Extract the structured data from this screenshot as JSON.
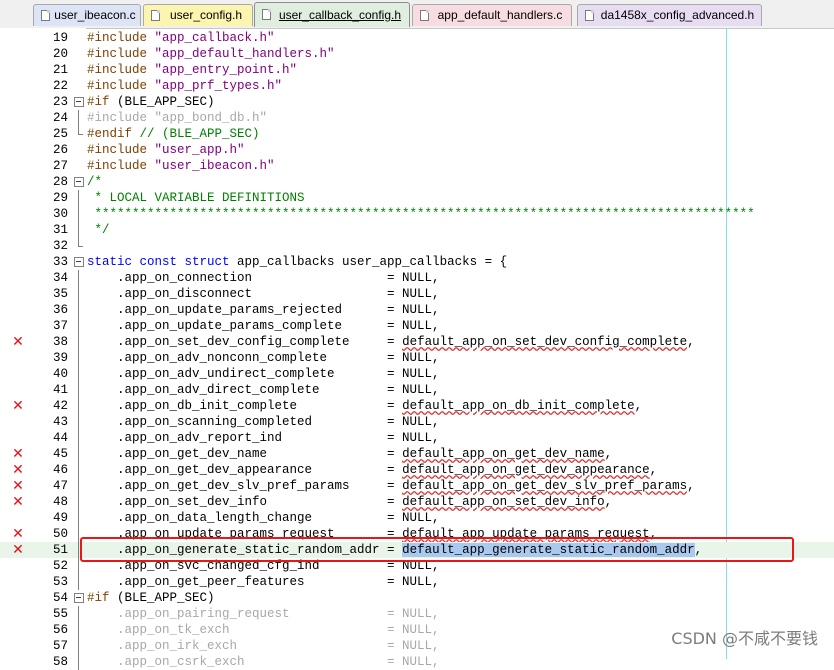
{
  "tabs": [
    {
      "label": "user_ibeacon.c",
      "bg": "#dde4f5",
      "active": false
    },
    {
      "label": "user_config.h",
      "bg": "#fbf5b0",
      "active": false
    },
    {
      "label": "user_callback_config.h",
      "bg": "#dfeede",
      "active": true
    },
    {
      "label": "app_default_handlers.c",
      "bg": "#f7dde2",
      "active": false
    },
    {
      "label": "da1458x_config_advanced.h",
      "bg": "#e6ddf2",
      "active": false
    }
  ],
  "lines": [
    {
      "num": "19",
      "fold": "",
      "marker": false,
      "tokens": [
        [
          "pp",
          "#include "
        ],
        [
          "str",
          "\"app_callback.h\""
        ]
      ]
    },
    {
      "num": "20",
      "fold": "",
      "marker": false,
      "tokens": [
        [
          "pp",
          "#include "
        ],
        [
          "str",
          "\"app_default_handlers.h\""
        ]
      ]
    },
    {
      "num": "21",
      "fold": "",
      "marker": false,
      "tokens": [
        [
          "pp",
          "#include "
        ],
        [
          "str",
          "\"app_entry_point.h\""
        ]
      ]
    },
    {
      "num": "22",
      "fold": "",
      "marker": false,
      "tokens": [
        [
          "pp",
          "#include "
        ],
        [
          "str",
          "\"app_prf_types.h\""
        ]
      ]
    },
    {
      "num": "23",
      "fold": "box",
      "marker": false,
      "tokens": [
        [
          "pp",
          "#if "
        ],
        [
          "txt",
          "(BLE_APP_SEC)"
        ]
      ]
    },
    {
      "num": "24",
      "fold": "bar",
      "marker": false,
      "tokens": [
        [
          "dim",
          "#include \"app_bond_db.h\""
        ]
      ]
    },
    {
      "num": "25",
      "fold": "end",
      "marker": false,
      "tokens": [
        [
          "pp",
          "#endif "
        ],
        [
          "cmt",
          "// (BLE_APP_SEC)"
        ]
      ]
    },
    {
      "num": "26",
      "fold": "",
      "marker": false,
      "tokens": [
        [
          "pp",
          "#include "
        ],
        [
          "str",
          "\"user_app.h\""
        ]
      ]
    },
    {
      "num": "27",
      "fold": "",
      "marker": false,
      "tokens": [
        [
          "pp",
          "#include "
        ],
        [
          "str",
          "\"user_ibeacon.h\""
        ]
      ]
    },
    {
      "num": "28",
      "fold": "box",
      "marker": false,
      "tokens": [
        [
          "cmt",
          "/*"
        ]
      ]
    },
    {
      "num": "29",
      "fold": "bar",
      "marker": false,
      "tokens": [
        [
          "cmt",
          " * LOCAL VARIABLE DEFINITIONS"
        ]
      ]
    },
    {
      "num": "30",
      "fold": "bar",
      "marker": false,
      "tokens": [
        [
          "cmt",
          " ****************************************************************************************"
        ]
      ]
    },
    {
      "num": "31",
      "fold": "bar",
      "marker": false,
      "tokens": [
        [
          "cmt",
          " */"
        ]
      ]
    },
    {
      "num": "32",
      "fold": "end",
      "marker": false,
      "tokens": []
    },
    {
      "num": "33",
      "fold": "box",
      "marker": false,
      "tokens": [
        [
          "kw",
          "static const struct "
        ],
        [
          "txt",
          "app_callbacks user_app_callbacks = {"
        ]
      ]
    },
    {
      "num": "34",
      "fold": "bar",
      "marker": false,
      "tokens": [
        [
          "txt",
          "    .app_on_connection                  = NULL,"
        ]
      ]
    },
    {
      "num": "35",
      "fold": "bar",
      "marker": false,
      "tokens": [
        [
          "txt",
          "    .app_on_disconnect                  = NULL,"
        ]
      ]
    },
    {
      "num": "36",
      "fold": "bar",
      "marker": false,
      "tokens": [
        [
          "txt",
          "    .app_on_update_params_rejected      = NULL,"
        ]
      ]
    },
    {
      "num": "37",
      "fold": "bar",
      "marker": false,
      "tokens": [
        [
          "txt",
          "    .app_on_update_params_complete      = NULL,"
        ]
      ]
    },
    {
      "num": "38",
      "fold": "bar",
      "marker": true,
      "tokens": [
        [
          "txt",
          "    .app_on_set_dev_config_complete     = "
        ],
        [
          "sq",
          "default_app_on_set_dev_config_complete"
        ],
        [
          "txt",
          ","
        ]
      ]
    },
    {
      "num": "39",
      "fold": "bar",
      "marker": false,
      "tokens": [
        [
          "txt",
          "    .app_on_adv_nonconn_complete        = NULL,"
        ]
      ]
    },
    {
      "num": "40",
      "fold": "bar",
      "marker": false,
      "tokens": [
        [
          "txt",
          "    .app_on_adv_undirect_complete       = NULL,"
        ]
      ]
    },
    {
      "num": "41",
      "fold": "bar",
      "marker": false,
      "tokens": [
        [
          "txt",
          "    .app_on_adv_direct_complete         = NULL,"
        ]
      ]
    },
    {
      "num": "42",
      "fold": "bar",
      "marker": true,
      "tokens": [
        [
          "txt",
          "    .app_on_db_init_complete            = "
        ],
        [
          "sq",
          "default_app_on_db_init_complete"
        ],
        [
          "txt",
          ","
        ]
      ]
    },
    {
      "num": "43",
      "fold": "bar",
      "marker": false,
      "tokens": [
        [
          "txt",
          "    .app_on_scanning_completed          = NULL,"
        ]
      ]
    },
    {
      "num": "44",
      "fold": "bar",
      "marker": false,
      "tokens": [
        [
          "txt",
          "    .app_on_adv_report_ind              = NULL,"
        ]
      ]
    },
    {
      "num": "45",
      "fold": "bar",
      "marker": true,
      "tokens": [
        [
          "txt",
          "    .app_on_get_dev_name                = "
        ],
        [
          "sq",
          "default_app_on_get_dev_name"
        ],
        [
          "txt",
          ","
        ]
      ]
    },
    {
      "num": "46",
      "fold": "bar",
      "marker": true,
      "tokens": [
        [
          "txt",
          "    .app_on_get_dev_appearance          = "
        ],
        [
          "sq",
          "default_app_on_get_dev_appearance"
        ],
        [
          "txt",
          ","
        ]
      ]
    },
    {
      "num": "47",
      "fold": "bar",
      "marker": true,
      "tokens": [
        [
          "txt",
          "    .app_on_get_dev_slv_pref_params     = "
        ],
        [
          "sq",
          "default_app_on_get_dev_slv_pref_params"
        ],
        [
          "txt",
          ","
        ]
      ]
    },
    {
      "num": "48",
      "fold": "bar",
      "marker": true,
      "tokens": [
        [
          "txt",
          "    .app_on_set_dev_info                = "
        ],
        [
          "sq",
          "default_app_on_set_dev_info"
        ],
        [
          "txt",
          ","
        ]
      ]
    },
    {
      "num": "49",
      "fold": "bar",
      "marker": false,
      "tokens": [
        [
          "txt",
          "    .app_on_data_length_change          = NULL,"
        ]
      ]
    },
    {
      "num": "50",
      "fold": "bar",
      "marker": true,
      "tokens": [
        [
          "txt",
          "    .app_on_update_params_request       = "
        ],
        [
          "sq",
          "default_app_update_params_request"
        ],
        [
          "txt",
          ","
        ]
      ]
    },
    {
      "num": "51",
      "fold": "bar",
      "marker": true,
      "current": true,
      "tokens": [
        [
          "txt",
          "    .app_on_generate_static_random_addr = "
        ],
        [
          "sel",
          "default_app_generate_static_random_addr"
        ],
        [
          "txt",
          ","
        ]
      ]
    },
    {
      "num": "52",
      "fold": "bar",
      "marker": false,
      "tokens": [
        [
          "txt",
          "    .app_on_svc_changed_cfg_ind         = NULL,"
        ]
      ]
    },
    {
      "num": "53",
      "fold": "bar",
      "marker": false,
      "tokens": [
        [
          "txt",
          "    .app_on_get_peer_features           = NULL,"
        ]
      ]
    },
    {
      "num": "54",
      "fold": "box",
      "marker": false,
      "tokens": [
        [
          "pp",
          "#if "
        ],
        [
          "txt",
          "(BLE_APP_SEC)"
        ]
      ]
    },
    {
      "num": "55",
      "fold": "bar",
      "marker": false,
      "tokens": [
        [
          "dim",
          "    .app_on_pairing_request             = NULL,"
        ]
      ]
    },
    {
      "num": "56",
      "fold": "bar",
      "marker": false,
      "tokens": [
        [
          "dim",
          "    .app_on_tk_exch                     = NULL,"
        ]
      ]
    },
    {
      "num": "57",
      "fold": "bar",
      "marker": false,
      "tokens": [
        [
          "dim",
          "    .app_on_irk_exch                    = NULL,"
        ]
      ]
    },
    {
      "num": "58",
      "fold": "bar",
      "marker": false,
      "tokens": [
        [
          "dim",
          "    .app_on_csrk_exch                   = NULL,"
        ]
      ]
    }
  ],
  "marker_glyph": "✕",
  "watermark": "CSDN @不咸不要钱"
}
